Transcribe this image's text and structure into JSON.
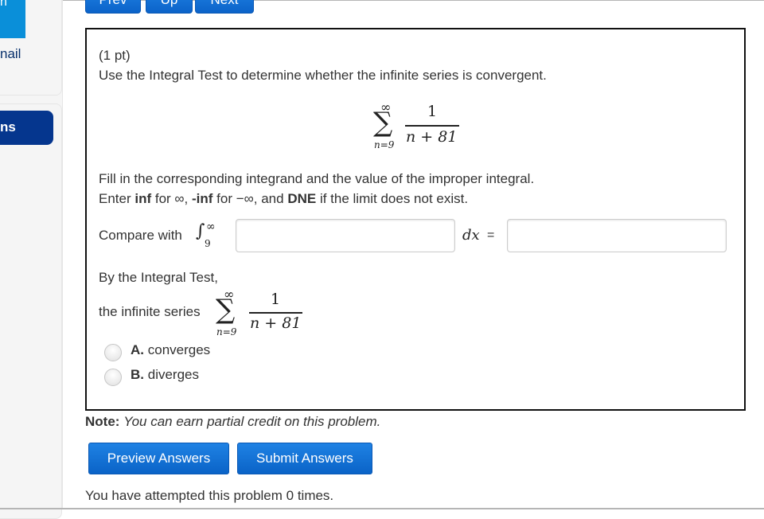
{
  "sidebar": {
    "top_button_fragment": "n",
    "link_fragment": "nail",
    "nav_button_fragment": "ns"
  },
  "nav": {
    "prev": "Prev",
    "up": "Up",
    "next": "Next"
  },
  "problem": {
    "points": "(1 pt)",
    "instruction": "Use the Integral Test to determine whether the infinite series is convergent.",
    "series": {
      "upper": "∞",
      "lower": "n=9",
      "numerator": "1",
      "denominator": "n + 81"
    },
    "fill_in": "Fill in the corresponding integrand and the value of the improper integral.",
    "enter_line": {
      "p1": "Enter ",
      "b1": "inf",
      "p2": " for ∞, ",
      "b2": "-inf",
      "p3": " for −∞, and ",
      "b3": "DNE",
      "p4": " if the limit does not exist."
    },
    "compare_label": "Compare with",
    "integral": {
      "symbol": "∫",
      "upper": "∞",
      "lower": "9"
    },
    "integrand_input": {
      "value": "",
      "placeholder": ""
    },
    "dx_label": "dx",
    "equals": "=",
    "value_input": {
      "value": "",
      "placeholder": ""
    },
    "by_test": "By the Integral Test,",
    "series_label": "the infinite series",
    "options": [
      {
        "letter": "A.",
        "label": "converges",
        "selected": false
      },
      {
        "letter": "B.",
        "label": "diverges",
        "selected": false
      }
    ]
  },
  "note": {
    "label": "Note:",
    "text": "You can earn partial credit on this problem."
  },
  "actions": {
    "preview": "Preview Answers",
    "submit": "Submit Answers"
  },
  "attempts": "You have attempted this problem 0 times."
}
